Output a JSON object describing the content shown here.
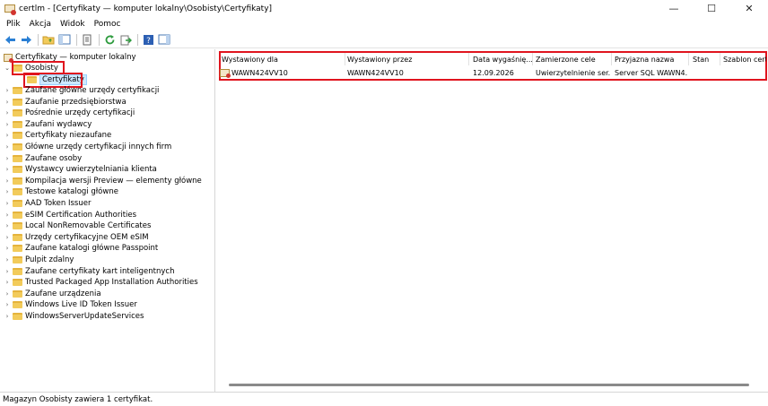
{
  "window": {
    "title": "certlm - [Certyfikaty — komputer lokalny\\Osobisty\\Certyfikaty]",
    "minimize": "—",
    "maximize": "☐",
    "close": "✕"
  },
  "menu": [
    "Plik",
    "Akcja",
    "Widok",
    "Pomoc"
  ],
  "toolbar_icons": [
    "back-icon",
    "forward-icon",
    "folder-up-icon",
    "show-tree-icon",
    "properties-icon",
    "refresh-icon",
    "export-icon",
    "help-icon",
    "show-pane-icon"
  ],
  "tree": {
    "root": "Certyfikaty — komputer lokalny",
    "expanded": "Osobisty",
    "selected_child": "Certyfikaty",
    "items": [
      "Zaufane główne urzędy certyfikacji",
      "Zaufanie przedsiębiorstwa",
      "Pośrednie urzędy certyfikacji",
      "Zaufani wydawcy",
      "Certyfikaty niezaufane",
      "Główne urzędy certyfikacji innych firm",
      "Zaufane osoby",
      "Wystawcy uwierzytelniania klienta",
      "Kompilacja wersji Preview — elementy główne",
      "Testowe katalogi główne",
      "AAD Token Issuer",
      "eSIM Certification Authorities",
      "Local NonRemovable Certificates",
      "Urzędy certyfikacyjne OEM eSIM",
      "Zaufane katalogi główne Passpoint",
      "Pulpit zdalny",
      "Zaufane certyfikaty kart inteligentnych",
      "Trusted Packaged App Installation Authorities",
      "Zaufane urządzenia",
      "Windows Live ID Token Issuer",
      "WindowsServerUpdateServices"
    ]
  },
  "table": {
    "columns": [
      "Wystawiony dla",
      "Wystawiony przez",
      "Data wygaśnię...",
      "Zamierzone cele",
      "Przyjazna nazwa",
      "Stan",
      "Szablon certy"
    ],
    "rows": [
      [
        "WAWN424VV10",
        "WAWN424VV10",
        "12.09.2026",
        "Uwierzytelnienie ser...",
        "Server SQL WAWN4...",
        "",
        ""
      ]
    ]
  },
  "status": "Magazyn Osobisty zawiera 1 certyfikat.",
  "colors": {
    "highlight_box": "#e0141e",
    "selection": "#cce8ff",
    "folder": "#f2cb5b"
  }
}
